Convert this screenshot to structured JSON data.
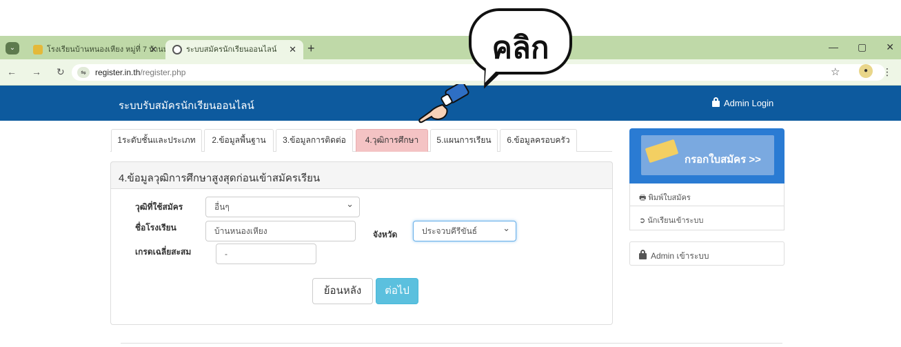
{
  "browser": {
    "tabs": [
      {
        "title": "โรงเรียนบ้านหนองเหียง หมู่ที่ 7 บ้านห..."
      },
      {
        "title": "ระบบสมัครนักเรียนออนไลน์"
      }
    ],
    "new_tab": "+",
    "url_host": "register.in.th",
    "url_path": "/register.php",
    "site_icon_glyph": "⇋"
  },
  "navbar": {
    "brand": "ระบบรับสมัครนักเรียนออนไลน์",
    "admin_login": "Admin Login"
  },
  "steps": [
    {
      "label": "1ระดับชั้นและประเภท",
      "active": false
    },
    {
      "label": "2.ข้อมูลพื้นฐาน",
      "active": false
    },
    {
      "label": "3.ข้อมูลการติดต่อ",
      "active": false
    },
    {
      "label": "4.วุฒิการศึกษา",
      "active": true
    },
    {
      "label": "5.แผนการเรียน",
      "active": false
    },
    {
      "label": "6.ข้อมูลครอบครัว",
      "active": false
    }
  ],
  "form": {
    "title": "4.ข้อมูลวุฒิการศึกษาสูงสุดก่อนเข้าสมัครเรียน",
    "qualification_label": "วุฒิที่ใช้สมัคร",
    "qualification_value": "อื่นๆ",
    "school_label": "ชื่อโรงเรียน",
    "school_value": "บ้านหนองเหียง",
    "province_label": "จังหวัด",
    "province_value": "ประจวบคีรีขันธ์",
    "gpa_label": "เกรดเฉลี่ยสะสม",
    "gpa_value": "-",
    "back_label": "ย้อนหลัง",
    "next_label": "ต่อไป"
  },
  "sidebar": {
    "apply_label": "กรอกใบสมัคร >>",
    "print_label": "พิมพ์ใบสมัคร",
    "student_login_label": "นักเรียนเข้าระบบ",
    "admin_entry_label": "Admin เข้าระบบ"
  },
  "callout": {
    "text": "คลิก"
  },
  "colors": {
    "navbar": "#0d5a9e",
    "active_tab": "#f4c3c4",
    "next_button": "#5bc0de",
    "browser_chrome": "#bfd9a8"
  }
}
